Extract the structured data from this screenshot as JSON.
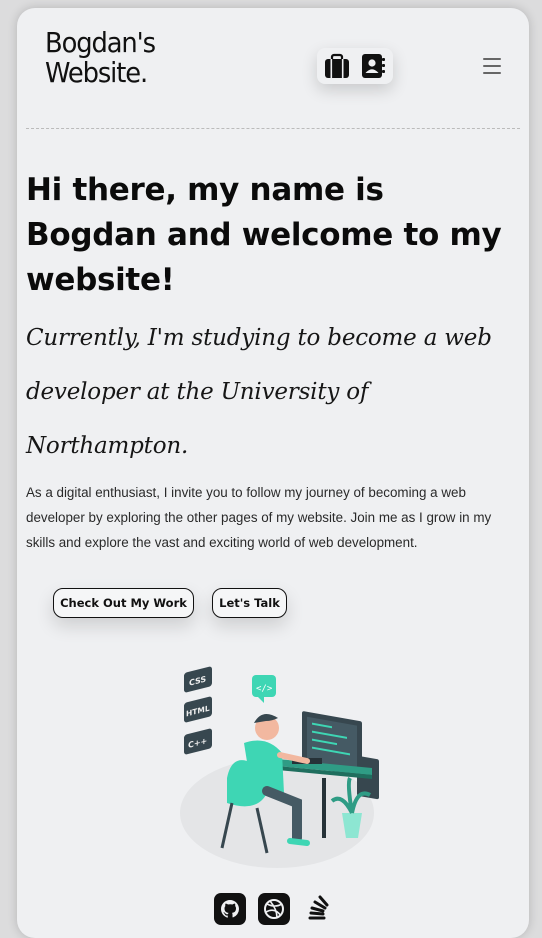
{
  "header": {
    "logo_line1": "Bogdan's",
    "logo_line2": "Website.",
    "nav_icons": [
      "briefcase-icon",
      "contact-book-icon"
    ],
    "menu_icon": "hamburger-menu-icon"
  },
  "hero": {
    "heading": "Hi there, my name is Bogdan and welcome to my website!",
    "subheading": "Currently, I'm studying to become a web developer at the University of Northampton.",
    "paragraph": "As a digital enthusiast, I invite you to follow my journey of becoming a web developer by exploring the other pages of my website. Join me as I grow in my skills and explore the vast and exciting world of web development.",
    "buttons": {
      "work_label": "Check Out My Work",
      "talk_label": "Let's Talk"
    },
    "illustration": {
      "tags": [
        "CSS",
        "HTML",
        "C++"
      ]
    }
  },
  "social": {
    "icons": [
      "github-icon",
      "dribbble-icon",
      "stackoverflow-icon"
    ]
  },
  "colors": {
    "accent": "#3ed6b4",
    "background": "#eff0f2",
    "text": "#0b0b0b"
  }
}
